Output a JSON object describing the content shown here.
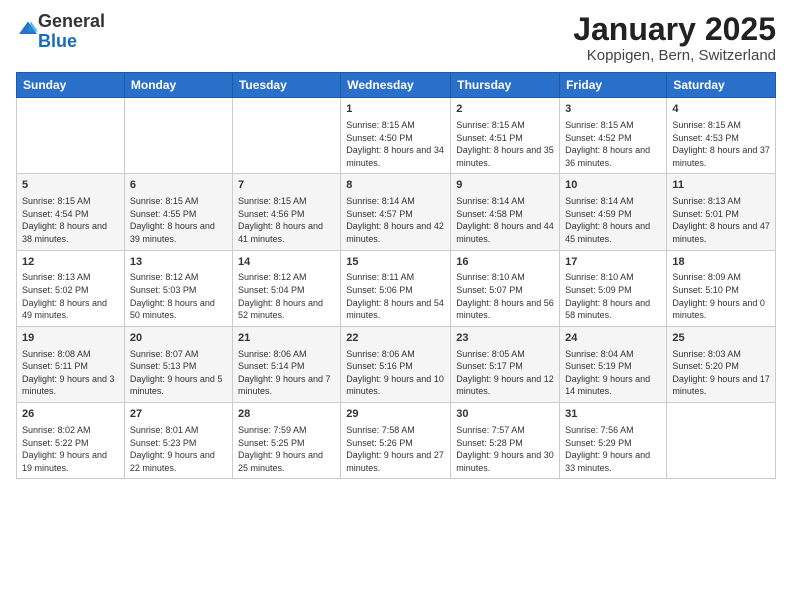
{
  "logo": {
    "general": "General",
    "blue": "Blue"
  },
  "title": "January 2025",
  "subtitle": "Koppigen, Bern, Switzerland",
  "days_of_week": [
    "Sunday",
    "Monday",
    "Tuesday",
    "Wednesday",
    "Thursday",
    "Friday",
    "Saturday"
  ],
  "weeks": [
    [
      {
        "day": "",
        "sunrise": "",
        "sunset": "",
        "daylight": ""
      },
      {
        "day": "",
        "sunrise": "",
        "sunset": "",
        "daylight": ""
      },
      {
        "day": "",
        "sunrise": "",
        "sunset": "",
        "daylight": ""
      },
      {
        "day": "1",
        "sunrise": "Sunrise: 8:15 AM",
        "sunset": "Sunset: 4:50 PM",
        "daylight": "Daylight: 8 hours and 34 minutes."
      },
      {
        "day": "2",
        "sunrise": "Sunrise: 8:15 AM",
        "sunset": "Sunset: 4:51 PM",
        "daylight": "Daylight: 8 hours and 35 minutes."
      },
      {
        "day": "3",
        "sunrise": "Sunrise: 8:15 AM",
        "sunset": "Sunset: 4:52 PM",
        "daylight": "Daylight: 8 hours and 36 minutes."
      },
      {
        "day": "4",
        "sunrise": "Sunrise: 8:15 AM",
        "sunset": "Sunset: 4:53 PM",
        "daylight": "Daylight: 8 hours and 37 minutes."
      }
    ],
    [
      {
        "day": "5",
        "sunrise": "Sunrise: 8:15 AM",
        "sunset": "Sunset: 4:54 PM",
        "daylight": "Daylight: 8 hours and 38 minutes."
      },
      {
        "day": "6",
        "sunrise": "Sunrise: 8:15 AM",
        "sunset": "Sunset: 4:55 PM",
        "daylight": "Daylight: 8 hours and 39 minutes."
      },
      {
        "day": "7",
        "sunrise": "Sunrise: 8:15 AM",
        "sunset": "Sunset: 4:56 PM",
        "daylight": "Daylight: 8 hours and 41 minutes."
      },
      {
        "day": "8",
        "sunrise": "Sunrise: 8:14 AM",
        "sunset": "Sunset: 4:57 PM",
        "daylight": "Daylight: 8 hours and 42 minutes."
      },
      {
        "day": "9",
        "sunrise": "Sunrise: 8:14 AM",
        "sunset": "Sunset: 4:58 PM",
        "daylight": "Daylight: 8 hours and 44 minutes."
      },
      {
        "day": "10",
        "sunrise": "Sunrise: 8:14 AM",
        "sunset": "Sunset: 4:59 PM",
        "daylight": "Daylight: 8 hours and 45 minutes."
      },
      {
        "day": "11",
        "sunrise": "Sunrise: 8:13 AM",
        "sunset": "Sunset: 5:01 PM",
        "daylight": "Daylight: 8 hours and 47 minutes."
      }
    ],
    [
      {
        "day": "12",
        "sunrise": "Sunrise: 8:13 AM",
        "sunset": "Sunset: 5:02 PM",
        "daylight": "Daylight: 8 hours and 49 minutes."
      },
      {
        "day": "13",
        "sunrise": "Sunrise: 8:12 AM",
        "sunset": "Sunset: 5:03 PM",
        "daylight": "Daylight: 8 hours and 50 minutes."
      },
      {
        "day": "14",
        "sunrise": "Sunrise: 8:12 AM",
        "sunset": "Sunset: 5:04 PM",
        "daylight": "Daylight: 8 hours and 52 minutes."
      },
      {
        "day": "15",
        "sunrise": "Sunrise: 8:11 AM",
        "sunset": "Sunset: 5:06 PM",
        "daylight": "Daylight: 8 hours and 54 minutes."
      },
      {
        "day": "16",
        "sunrise": "Sunrise: 8:10 AM",
        "sunset": "Sunset: 5:07 PM",
        "daylight": "Daylight: 8 hours and 56 minutes."
      },
      {
        "day": "17",
        "sunrise": "Sunrise: 8:10 AM",
        "sunset": "Sunset: 5:09 PM",
        "daylight": "Daylight: 8 hours and 58 minutes."
      },
      {
        "day": "18",
        "sunrise": "Sunrise: 8:09 AM",
        "sunset": "Sunset: 5:10 PM",
        "daylight": "Daylight: 9 hours and 0 minutes."
      }
    ],
    [
      {
        "day": "19",
        "sunrise": "Sunrise: 8:08 AM",
        "sunset": "Sunset: 5:11 PM",
        "daylight": "Daylight: 9 hours and 3 minutes."
      },
      {
        "day": "20",
        "sunrise": "Sunrise: 8:07 AM",
        "sunset": "Sunset: 5:13 PM",
        "daylight": "Daylight: 9 hours and 5 minutes."
      },
      {
        "day": "21",
        "sunrise": "Sunrise: 8:06 AM",
        "sunset": "Sunset: 5:14 PM",
        "daylight": "Daylight: 9 hours and 7 minutes."
      },
      {
        "day": "22",
        "sunrise": "Sunrise: 8:06 AM",
        "sunset": "Sunset: 5:16 PM",
        "daylight": "Daylight: 9 hours and 10 minutes."
      },
      {
        "day": "23",
        "sunrise": "Sunrise: 8:05 AM",
        "sunset": "Sunset: 5:17 PM",
        "daylight": "Daylight: 9 hours and 12 minutes."
      },
      {
        "day": "24",
        "sunrise": "Sunrise: 8:04 AM",
        "sunset": "Sunset: 5:19 PM",
        "daylight": "Daylight: 9 hours and 14 minutes."
      },
      {
        "day": "25",
        "sunrise": "Sunrise: 8:03 AM",
        "sunset": "Sunset: 5:20 PM",
        "daylight": "Daylight: 9 hours and 17 minutes."
      }
    ],
    [
      {
        "day": "26",
        "sunrise": "Sunrise: 8:02 AM",
        "sunset": "Sunset: 5:22 PM",
        "daylight": "Daylight: 9 hours and 19 minutes."
      },
      {
        "day": "27",
        "sunrise": "Sunrise: 8:01 AM",
        "sunset": "Sunset: 5:23 PM",
        "daylight": "Daylight: 9 hours and 22 minutes."
      },
      {
        "day": "28",
        "sunrise": "Sunrise: 7:59 AM",
        "sunset": "Sunset: 5:25 PM",
        "daylight": "Daylight: 9 hours and 25 minutes."
      },
      {
        "day": "29",
        "sunrise": "Sunrise: 7:58 AM",
        "sunset": "Sunset: 5:26 PM",
        "daylight": "Daylight: 9 hours and 27 minutes."
      },
      {
        "day": "30",
        "sunrise": "Sunrise: 7:57 AM",
        "sunset": "Sunset: 5:28 PM",
        "daylight": "Daylight: 9 hours and 30 minutes."
      },
      {
        "day": "31",
        "sunrise": "Sunrise: 7:56 AM",
        "sunset": "Sunset: 5:29 PM",
        "daylight": "Daylight: 9 hours and 33 minutes."
      },
      {
        "day": "",
        "sunrise": "",
        "sunset": "",
        "daylight": ""
      }
    ]
  ]
}
